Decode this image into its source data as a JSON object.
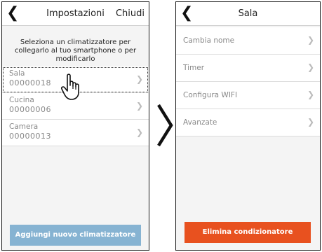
{
  "left_screen": {
    "header": {
      "back_icon": "chevron-left-icon",
      "title": "Impostazioni",
      "close_label": "Chiudi"
    },
    "instructions": "Seleziona un climatizzatore per collegarlo al tuo smartphone o per modificarlo",
    "devices": [
      {
        "name": "Sala",
        "code": "00000018"
      },
      {
        "name": "Cucina",
        "code": "00000006"
      },
      {
        "name": "Camera",
        "code": "00000013"
      }
    ],
    "selected_index": 0,
    "add_button_label": "Aggiungi nuovo climatizzatore"
  },
  "right_screen": {
    "header": {
      "back_icon": "chevron-left-icon",
      "title": "Sala"
    },
    "menu": [
      {
        "label": "Cambia nome"
      },
      {
        "label": "Timer"
      },
      {
        "label": "Configura WIFI"
      },
      {
        "label": "Avanzate"
      }
    ],
    "delete_button_label": "Elimina condizionatore"
  },
  "colors": {
    "add_button": "#86b3d2",
    "delete_button": "#e8511f",
    "background": "#f4f4f4"
  },
  "icons": {
    "transition": "chevron-right-icon",
    "cursor": "hand-pointer-icon",
    "row_arrow": "chevron-right-icon"
  }
}
